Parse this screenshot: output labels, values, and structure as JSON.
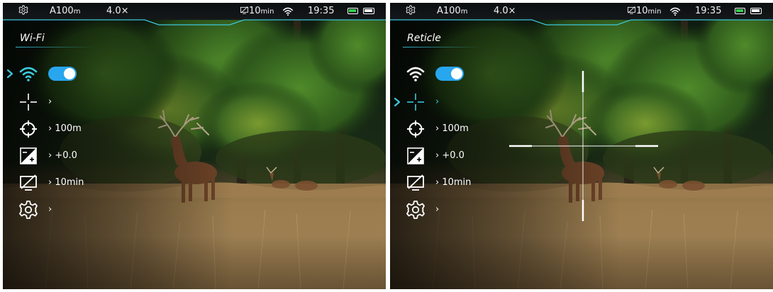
{
  "panels": [
    {
      "status": {
        "range_value": "A100",
        "range_unit": "m",
        "zoom": "4.0×",
        "screen_off_value": "10",
        "screen_off_unit": "min",
        "time": "19:35"
      },
      "menu": {
        "title": "Wi-Fi",
        "items": [
          {
            "icon": "wifi-icon",
            "value": "",
            "selected": true,
            "toggle": "on"
          },
          {
            "icon": "reticle-icon",
            "value": "",
            "selected": false
          },
          {
            "icon": "zeroing-icon",
            "value": "100m",
            "selected": false
          },
          {
            "icon": "brightness-icon",
            "value": "+0.0",
            "selected": false
          },
          {
            "icon": "screen-off-icon",
            "value": "10min",
            "selected": false
          },
          {
            "icon": "settings-icon",
            "value": "",
            "selected": false
          }
        ]
      }
    },
    {
      "status": {
        "range_value": "A100",
        "range_unit": "m",
        "zoom": "4.0×",
        "screen_off_value": "10",
        "screen_off_unit": "min",
        "time": "19:35"
      },
      "menu": {
        "title": "Reticle",
        "items": [
          {
            "icon": "wifi-icon",
            "value": "",
            "selected": false,
            "toggle": "on"
          },
          {
            "icon": "reticle-icon",
            "value": "",
            "selected": true
          },
          {
            "icon": "zeroing-icon",
            "value": "100m",
            "selected": false
          },
          {
            "icon": "brightness-icon",
            "value": "+0.0",
            "selected": false
          },
          {
            "icon": "screen-off-icon",
            "value": "10min",
            "selected": false
          },
          {
            "icon": "settings-icon",
            "value": "",
            "selected": false
          }
        ]
      },
      "reticle_shown": true
    }
  ],
  "colors": {
    "accent": "#3cc8dc",
    "toggle": "#28a6ee",
    "battery": "#2fcf4a",
    "icon": "#ffffff"
  }
}
